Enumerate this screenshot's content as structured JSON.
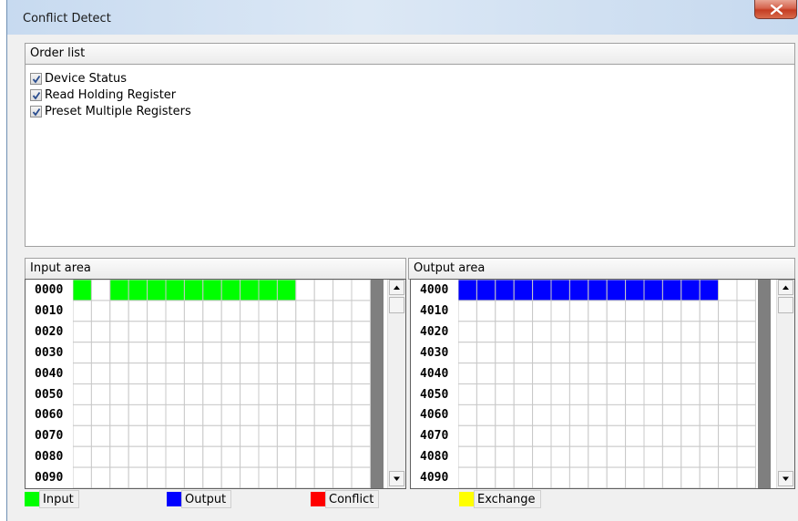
{
  "window": {
    "title": "Conflict Detect"
  },
  "order_list": {
    "header": "Order list",
    "items": [
      {
        "label": "Device Status",
        "checked": true
      },
      {
        "label": "Read Holding Register",
        "checked": true
      },
      {
        "label": "Preset Multiple Registers",
        "checked": true
      }
    ]
  },
  "input_area": {
    "header": "Input area",
    "addresses": [
      "0000",
      "0010",
      "0020",
      "0030",
      "0040",
      "0050",
      "0060",
      "0070",
      "0080",
      "0090"
    ],
    "filled_row0_cells": [
      0,
      2,
      3,
      4,
      5,
      6,
      7,
      8,
      9,
      10,
      11
    ],
    "fill_color": "#00ff00"
  },
  "output_area": {
    "header": "Output area",
    "addresses": [
      "4000",
      "4010",
      "4020",
      "4030",
      "4040",
      "4050",
      "4060",
      "4070",
      "4080",
      "4090"
    ],
    "filled_row0_cells": [
      0,
      1,
      2,
      3,
      4,
      5,
      6,
      7,
      8,
      9,
      10,
      11,
      12,
      13
    ],
    "fill_color": "#0000ff"
  },
  "legend": [
    {
      "label": "Input",
      "color": "#00ff00"
    },
    {
      "label": "Output",
      "color": "#0000ff"
    },
    {
      "label": "Conflict",
      "color": "#ff0000"
    },
    {
      "label": "Exchange",
      "color": "#ffff00"
    }
  ],
  "icons": {
    "close": "close-icon",
    "check": "checkmark-icon",
    "scroll_up": "arrow-up-icon",
    "scroll_down": "arrow-down-icon"
  }
}
